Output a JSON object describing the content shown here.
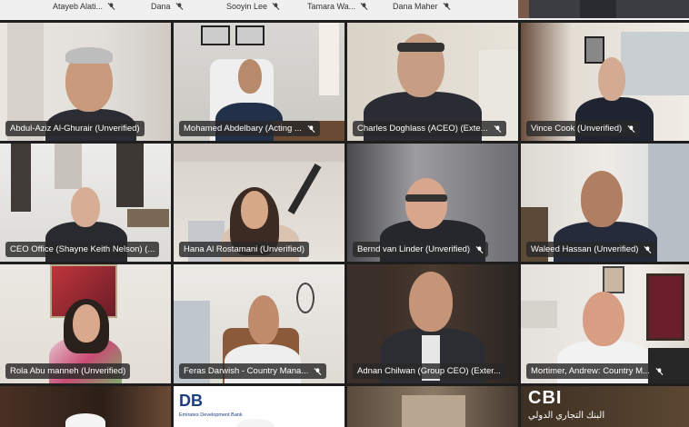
{
  "top_strip": {
    "participants": [
      {
        "name": "Atayeb Alati..."
      },
      {
        "name": "Dana"
      },
      {
        "name": "Sooyin Lee"
      },
      {
        "name": "Tamara Wa..."
      },
      {
        "name": "Dana Maher"
      }
    ]
  },
  "tiles": [
    {
      "name": "Abdul-Aziz Al-Ghurair (Unverified)",
      "muted": false
    },
    {
      "name": "Mohamed Abdelbary (Acting ...",
      "muted": true
    },
    {
      "name": "Charles Doghlass (ACEO) (Exte...",
      "muted": true
    },
    {
      "name": "Vince Cook (Unverified)",
      "muted": true
    },
    {
      "name": "CEO Office (Shayne Keith Nelson) (...",
      "muted": false
    },
    {
      "name": "Hana Al Rostamani (Unverified)",
      "muted": false
    },
    {
      "name": "Bernd van Linder (Unverified)",
      "muted": true
    },
    {
      "name": "Waleed Hassan (Unverified)",
      "muted": true
    },
    {
      "name": "Rola Abu manneh (Unverified)",
      "muted": false
    },
    {
      "name": "Feras Darwish - Country Mana...",
      "muted": true
    },
    {
      "name": "Adnan Chilwan (Group CEO) (Exter...",
      "muted": false
    },
    {
      "name": "Mortimer, Andrew: Country M...",
      "muted": true
    }
  ],
  "bottom_logos": {
    "dbd_text": "DB",
    "dbd_sub": "Emirates Development Bank",
    "cbi_text": "CBI",
    "cbi_arabic": "البنك التجاري الدولي"
  }
}
